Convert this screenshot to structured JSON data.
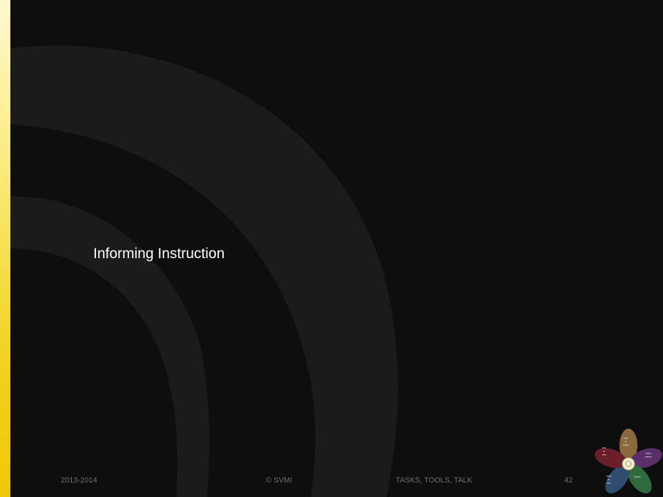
{
  "slide": {
    "title": "Informing Instruction"
  },
  "footer": {
    "year": "2013-2014",
    "copyright": "© SVMI",
    "tagline": "TASKS, TOOLS, TALK",
    "page_number": "42"
  },
  "theme": {
    "accent_bar_top": "#fff8cf",
    "accent_bar_bottom": "#f0c800",
    "background": "#0e0e0e",
    "swoosh": "#1b1b1b"
  },
  "logo": {
    "petal_colors": {
      "top": "#8a6a3c",
      "right": "#5a2d6b",
      "bottom_right": "#2f6b3e",
      "bottom_left": "#2f4d70",
      "left": "#6a1f2a"
    }
  }
}
